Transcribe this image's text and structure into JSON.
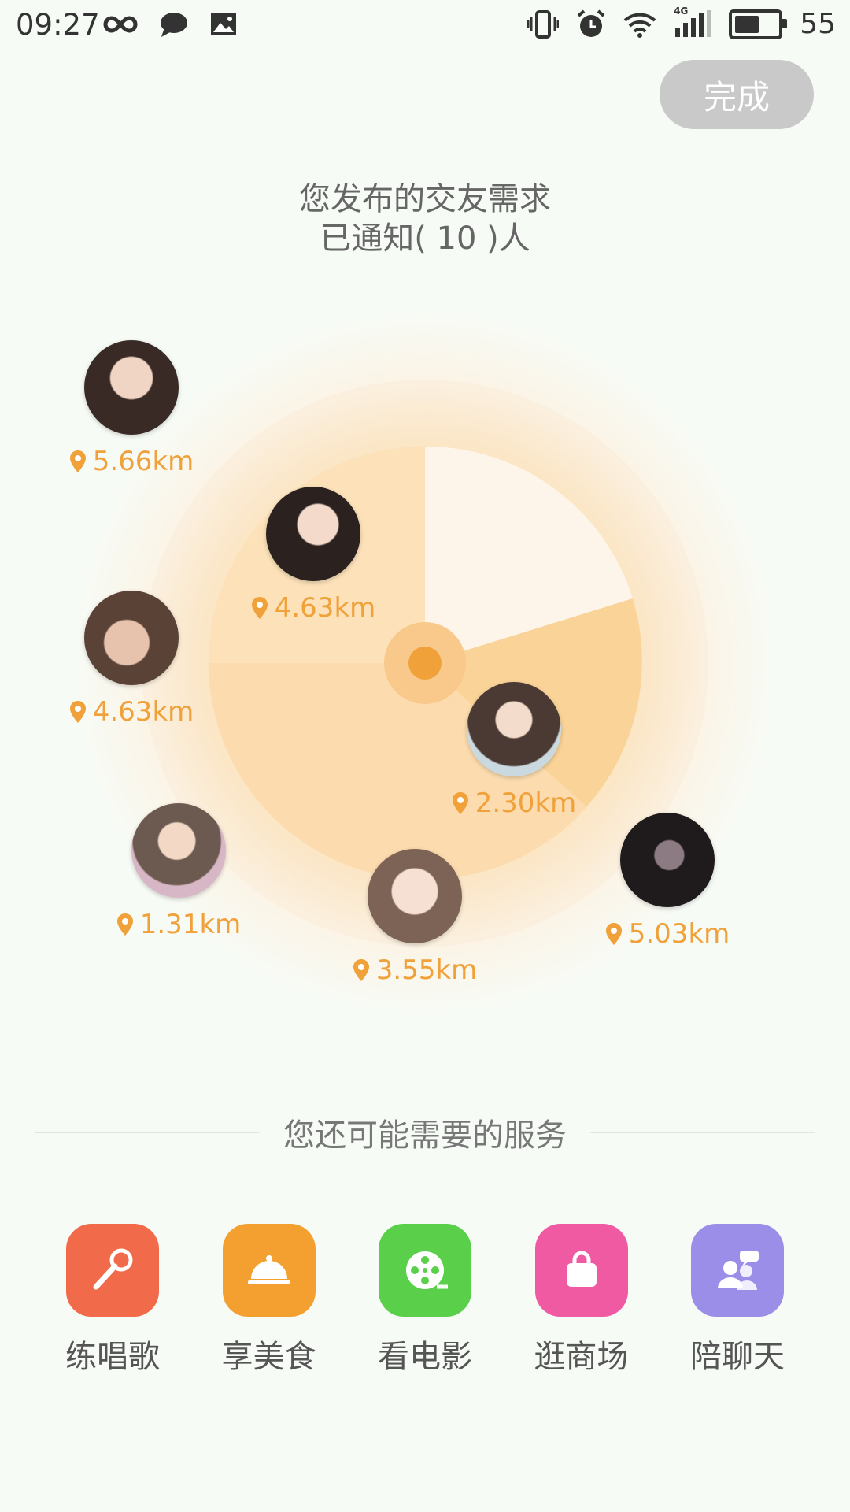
{
  "status_bar": {
    "time": "09:27",
    "battery": "55",
    "network": "4G"
  },
  "header": {
    "done_label": "完成"
  },
  "notice": {
    "line1": "您发布的交友需求",
    "line2": "已通知( 10 )人"
  },
  "radar": {
    "accent_color": "#f0a13a",
    "people": [
      {
        "distance": "5.66km",
        "avatar_color": "#3a2a26"
      },
      {
        "distance": "4.63km",
        "avatar_color": "#2b221f"
      },
      {
        "distance": "4.63km",
        "avatar_color": "#5a4236"
      },
      {
        "distance": "2.30km",
        "avatar_color": "#4b3a33"
      },
      {
        "distance": "1.31km",
        "avatar_color": "#6c5a50"
      },
      {
        "distance": "3.55km",
        "avatar_color": "#7d6356"
      },
      {
        "distance": "5.03km",
        "avatar_color": "#1f1a1c"
      }
    ]
  },
  "services": {
    "title": "您还可能需要的服务",
    "items": [
      {
        "label": "练唱歌",
        "icon": "microphone-icon",
        "color": "#f16a4a"
      },
      {
        "label": "享美食",
        "icon": "food-cloche-icon",
        "color": "#f4a030"
      },
      {
        "label": "看电影",
        "icon": "film-reel-icon",
        "color": "#59cf4a"
      },
      {
        "label": "逛商场",
        "icon": "shopping-bag-icon",
        "color": "#f05aa3"
      },
      {
        "label": "陪聊天",
        "icon": "chat-people-icon",
        "color": "#9b8ee8"
      }
    ]
  }
}
